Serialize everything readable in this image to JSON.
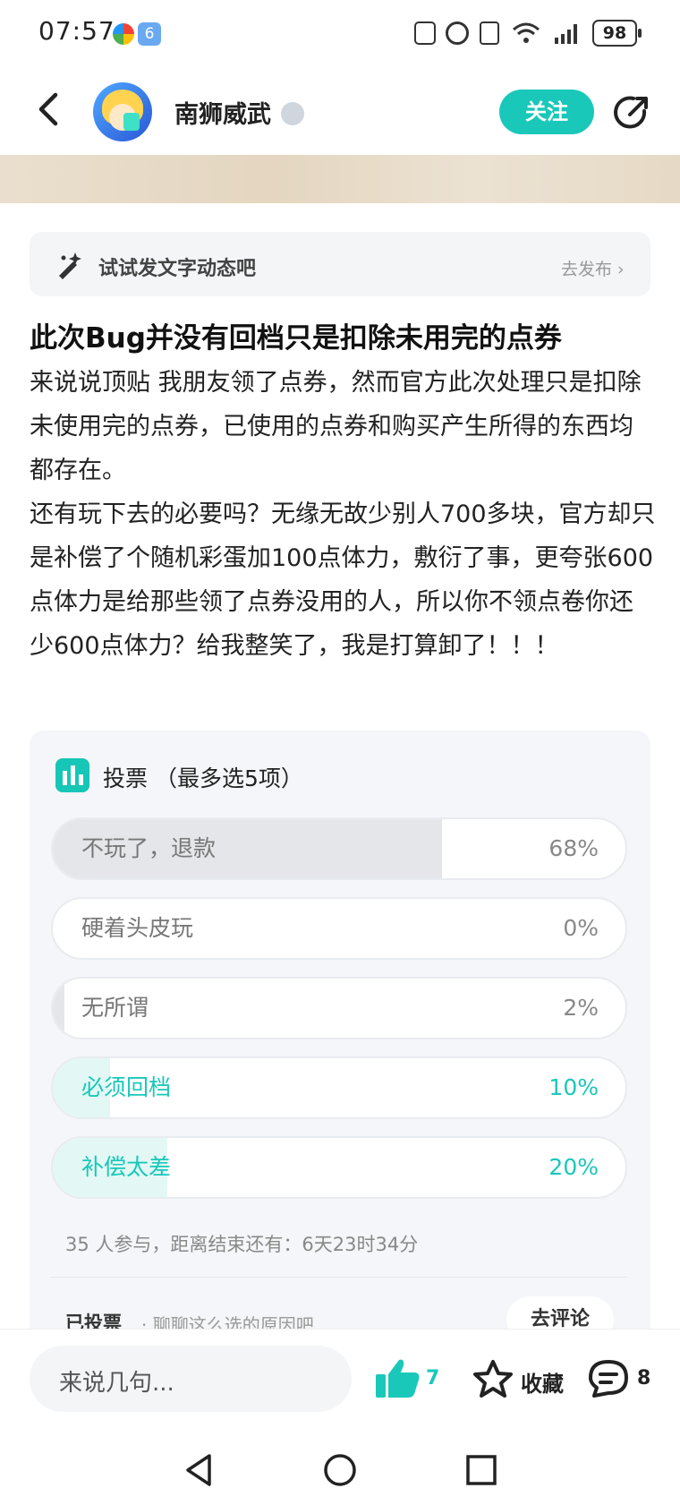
{
  "status_bar": {
    "time": "07:57",
    "battery": "98"
  },
  "header": {
    "username": "南狮威武",
    "follow_label": "关注"
  },
  "prompt_bar": {
    "text": "试试发文字动态吧",
    "action": "去发布 ›"
  },
  "post": {
    "title": "此次Bug并没有回档只是扣除未用完的点券",
    "paragraphs": [
      "来说说顶贴 我朋友领了点券，然而官方此次处理只是扣除未使用完的点券，已使用的点券和购买产生所得的东西均都存在。",
      "还有玩下去的必要吗？无缘无故少别人700多块，官方却只是补偿了个随机彩蛋加100点体力，敷衍了事，更夸张600点体力是给那些领了点券没用的人，所以你不领点卷你还少600点体力？给我整笑了，我是打算卸了！！！"
    ]
  },
  "poll": {
    "title": "投票 （最多选5项）",
    "options": [
      {
        "label": "不玩了，退款",
        "percent": "68%",
        "fraction": 0.68
      },
      {
        "label": "硬着头皮玩",
        "percent": "0%",
        "fraction": 0.0
      },
      {
        "label": "无所谓",
        "percent": "2%",
        "fraction": 0.02
      },
      {
        "label": "必须回档",
        "percent": "10%",
        "fraction": 0.1
      },
      {
        "label": "补偿太差",
        "percent": "20%",
        "fraction": 0.2
      }
    ],
    "meta": "35 人参与，距离结束还有：6天23时34分",
    "voted_label": "已投票",
    "voted_sub": "· 聊聊这么选的原因吧",
    "comment_button": "去评论"
  },
  "bottom_bar": {
    "comment_placeholder": "来说几句...",
    "like_count": "7",
    "favorite_label": "收藏",
    "comment_count": "8"
  },
  "colors": {
    "accent": "#19c8b9",
    "neutral_fill": "#e4e6ea",
    "accent_fill": "#e3f8f5"
  },
  "icons": [
    "back-arrow-icon",
    "share-icon",
    "pen-sparkle-icon",
    "bar-chart-icon",
    "thumbs-up-icon",
    "star-icon",
    "comment-bubble-icon",
    "nav-back-icon",
    "nav-home-icon",
    "nav-recents-icon"
  ]
}
